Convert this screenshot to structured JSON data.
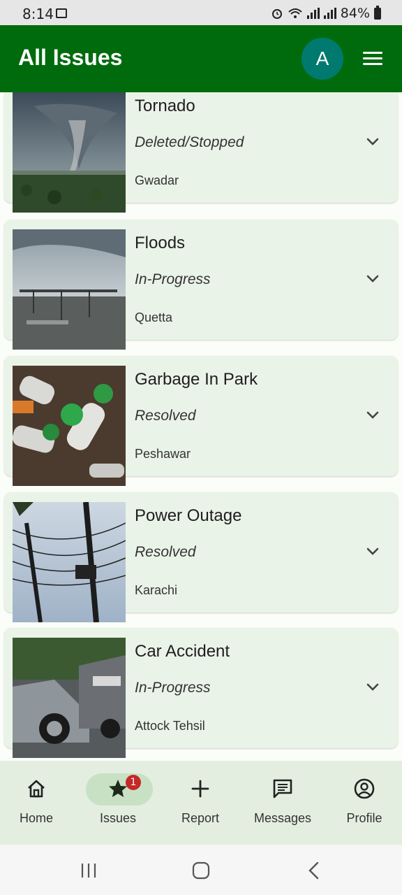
{
  "status_bar": {
    "time": "8:14",
    "battery": "84%"
  },
  "app_bar": {
    "title": "All Issues",
    "avatar_letter": "A"
  },
  "issues": [
    {
      "title": "Tornado",
      "status": "Deleted/Stopped",
      "location": "Gwadar"
    },
    {
      "title": "Floods",
      "status": "In-Progress",
      "location": "Quetta"
    },
    {
      "title": "Garbage In Park",
      "status": "Resolved",
      "location": "Peshawar"
    },
    {
      "title": "Power Outage",
      "status": "Resolved",
      "location": "Karachi"
    },
    {
      "title": "Car Accident",
      "status": "In-Progress",
      "location": "Attock Tehsil"
    }
  ],
  "bottom_nav": {
    "items": [
      {
        "label": "Home",
        "icon": "home-icon"
      },
      {
        "label": "Issues",
        "icon": "star-icon",
        "badge": "1",
        "active": true
      },
      {
        "label": "Report",
        "icon": "plus-icon"
      },
      {
        "label": "Messages",
        "icon": "message-icon"
      },
      {
        "label": "Profile",
        "icon": "account-circle-icon"
      }
    ]
  },
  "colors": {
    "app_bar": "#006b0d",
    "avatar": "#007a6e",
    "card_bg": "#eaf3e8",
    "nav_bg": "#e3eee0",
    "badge": "#c62828"
  }
}
